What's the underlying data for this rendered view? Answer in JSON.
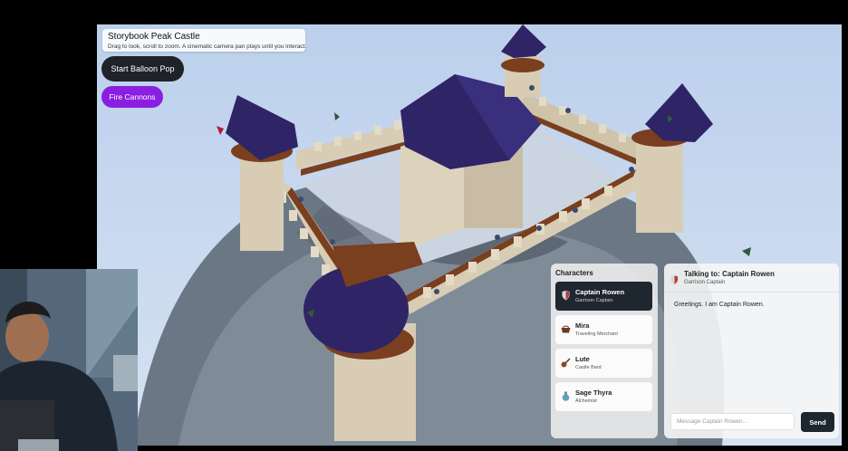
{
  "scene": {
    "title": "Storybook Peak Castle",
    "subtitle": "Drag to look, scroll to zoom. A cinematic camera pan plays until you interact."
  },
  "controls": {
    "balloon_label": "Start Balloon Pop",
    "cannon_label": "Fire Cannons"
  },
  "characters_panel": {
    "heading": "Characters",
    "items": [
      {
        "name": "Captain Rowen",
        "role": "Garrison Captain",
        "icon": "shield-icon",
        "active": true
      },
      {
        "name": "Mira",
        "role": "Traveling Merchant",
        "icon": "basket-icon",
        "active": false
      },
      {
        "name": "Lute",
        "role": "Castle Bard",
        "icon": "lute-icon",
        "active": false
      },
      {
        "name": "Sage Thyra",
        "role": "Alchemist",
        "icon": "potion-icon",
        "active": false
      }
    ]
  },
  "chat": {
    "title": "Talking to: Captain Rowen",
    "subtitle": "Garrison Captain",
    "message": "Greetings. I am Captain Rowen.",
    "input_placeholder": "Message Captain Rowen...",
    "send_label": "Send"
  },
  "colors": {
    "sky": "#c9daf0",
    "stone": "#d8cdb4",
    "roof": "#2e2466",
    "wood": "#7a3f1e",
    "accent_purple": "#8b1fe0",
    "dark_button": "#1f2328"
  }
}
